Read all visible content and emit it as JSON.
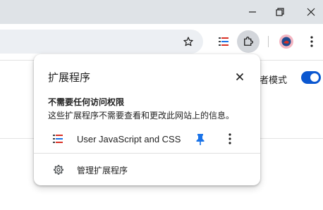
{
  "window": {
    "minimize_icon": "minimize-icon",
    "restore_icon": "restore-icon",
    "close_icon": "close-icon"
  },
  "toolbar": {
    "bookmark_icon": "star-icon",
    "extension_icon": "user-js-css-icon",
    "extensions_menu_icon": "puzzle-icon",
    "profile_icon": "profile-avatar-icon",
    "menu_icon": "kebab-menu-icon"
  },
  "page": {
    "partial_text": "者模式",
    "toggle_on": true
  },
  "popup": {
    "title": "扩展程序",
    "section_heading": "不需要任何访问权限",
    "section_description": "这些扩展程序不需要查看和更改此网站上的信息。",
    "extensions": [
      {
        "name": "User JavaScript and CSS",
        "pinned": true
      }
    ],
    "manage_label": "管理扩展程序"
  },
  "colors": {
    "titlebar": "#dfe3e7",
    "omnibox": "#eceff3",
    "accent": "#0b57d0",
    "pin": "#1a73e8"
  }
}
